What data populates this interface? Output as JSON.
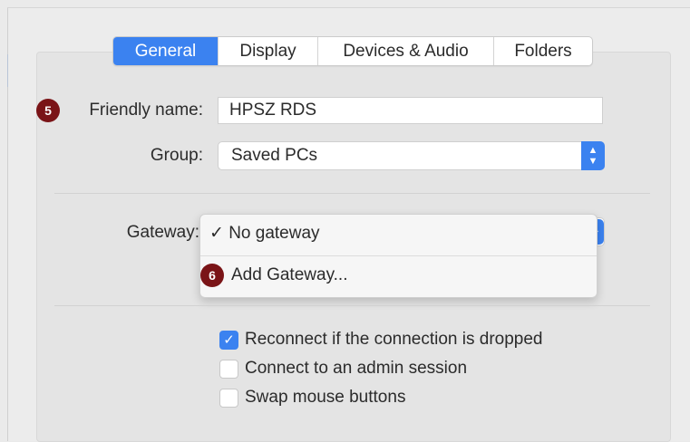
{
  "tabs": [
    {
      "label": "General",
      "active": true
    },
    {
      "label": "Display",
      "active": false
    },
    {
      "label": "Devices & Audio",
      "active": false
    },
    {
      "label": "Folders",
      "active": false
    }
  ],
  "friendly_name": {
    "badge": "5",
    "label": "Friendly name:",
    "value": "HPSZ RDS"
  },
  "group": {
    "label": "Group:",
    "value": "Saved PCs"
  },
  "gateway": {
    "label": "Gateway:",
    "menu": {
      "checkmark": "✓",
      "items": [
        {
          "label": "No gateway",
          "selected": true
        },
        {
          "badge": "6",
          "label": "Add Gateway..."
        }
      ]
    }
  },
  "options": [
    {
      "label": "Reconnect if the connection is dropped",
      "checked": true
    },
    {
      "label": "Connect to an admin session",
      "checked": false
    },
    {
      "label": "Swap mouse buttons",
      "checked": false
    }
  ],
  "colors": {
    "accent": "#3b82f0",
    "badge": "#7a1417"
  }
}
